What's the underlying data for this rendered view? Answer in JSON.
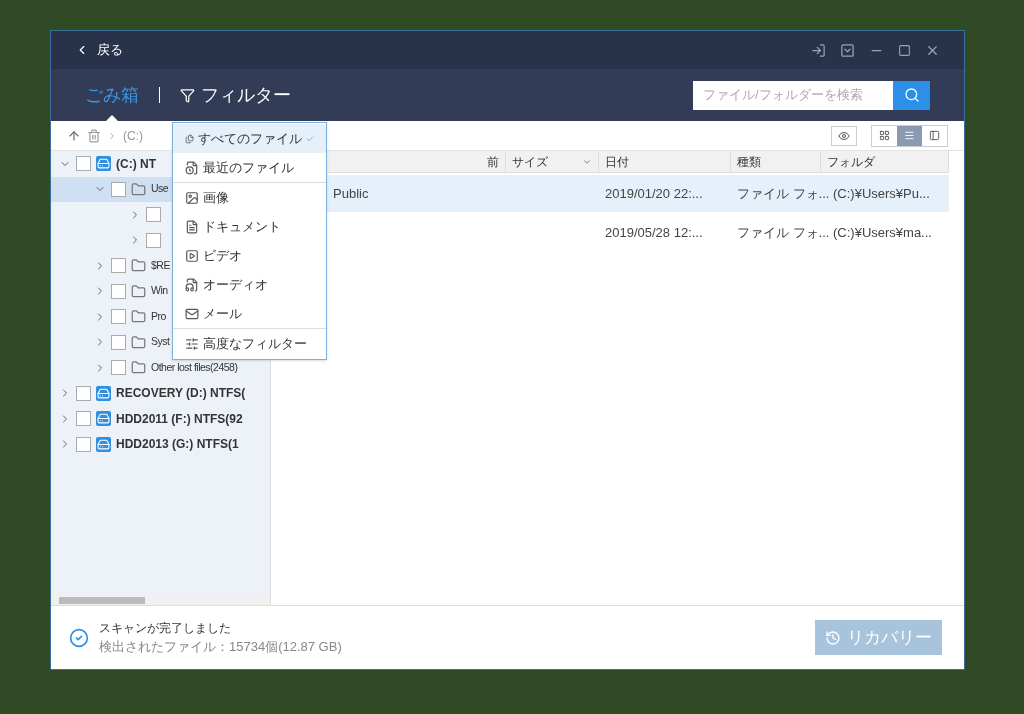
{
  "window": {
    "back": "戻る"
  },
  "header": {
    "tabs": [
      {
        "label": "ごみ箱",
        "selected": true,
        "kind": "plain"
      },
      {
        "label": "フィルター",
        "selected": false,
        "kind": "filter"
      }
    ],
    "search": {
      "placeholder": "ファイル/フォルダーを検索"
    }
  },
  "toolbar": {
    "breadcrumb": [
      "(C:)"
    ],
    "views": [
      {
        "kind": "grid",
        "selected": false
      },
      {
        "kind": "list",
        "selected": true
      },
      {
        "kind": "panel",
        "selected": false
      }
    ]
  },
  "tree": [
    {
      "kind": "drive",
      "label": "(C:) NT",
      "expanded": true,
      "checked": false,
      "children": [
        {
          "kind": "folder",
          "label": "Use",
          "expanded": true,
          "checked": false,
          "selected": true,
          "children": [
            {
              "expanded": false,
              "checked": false
            },
            {
              "expanded": false,
              "checked": false
            }
          ]
        },
        {
          "kind": "folder",
          "label": "$RE",
          "expanded": false,
          "checked": false
        },
        {
          "kind": "folder",
          "label": "Win",
          "expanded": false,
          "checked": false
        },
        {
          "kind": "folder",
          "label": "Pro",
          "expanded": false,
          "checked": false
        },
        {
          "kind": "folder",
          "label": "Syst",
          "expanded": false,
          "checked": false
        },
        {
          "kind": "folder",
          "label": "Other lost files(2458)",
          "expanded": false,
          "checked": false
        }
      ]
    },
    {
      "kind": "drive",
      "label": "RECOVERY (D:) NTFS(",
      "expanded": false,
      "checked": false
    },
    {
      "kind": "drive",
      "label": "HDD2011 (F:) NTFS(92",
      "expanded": false,
      "checked": false
    },
    {
      "kind": "drive",
      "label": "HDD2013 (G:) NTFS(1",
      "expanded": false,
      "checked": false
    }
  ],
  "table": {
    "columns": [
      {
        "label": "前",
        "sortable": false
      },
      {
        "label": "サイズ",
        "sortable": true
      },
      {
        "label": "日付",
        "sortable": false
      },
      {
        "label": "種類",
        "sortable": false
      },
      {
        "label": "フォルダ",
        "sortable": false
      }
    ],
    "rows": [
      {
        "selected": true,
        "cells": [
          "Public",
          "",
          "2019/01/20 22:...",
          "ファイル フォ...",
          "(C:)¥Users¥Pu..."
        ]
      },
      {
        "selected": false,
        "cells": [
          "",
          "",
          "2019/05/28 12:...",
          "ファイル フォ...",
          "(C:)¥Users¥ma..."
        ]
      }
    ]
  },
  "filter_menu": {
    "sections": [
      [
        {
          "kind": "all",
          "label": "すべてのファイル",
          "selected": true
        },
        {
          "kind": "recent",
          "label": "最近のファイル",
          "selected": false
        }
      ],
      [
        {
          "kind": "image",
          "label": "画像",
          "selected": false
        },
        {
          "kind": "document",
          "label": "ドキュメント",
          "selected": false
        },
        {
          "kind": "video",
          "label": "ビデオ",
          "selected": false
        },
        {
          "kind": "audio",
          "label": "オーディオ",
          "selected": false
        },
        {
          "kind": "mail",
          "label": "メール",
          "selected": false
        }
      ],
      [
        {
          "kind": "advanced",
          "label": "高度なフィルター",
          "selected": false
        }
      ]
    ]
  },
  "status_bar": {
    "title": "スキャンが完了しました",
    "detail": "検出されたファイル：15734個(12.87 GB)",
    "recover_button": {
      "label": "リカバリー",
      "disabled": true
    }
  }
}
